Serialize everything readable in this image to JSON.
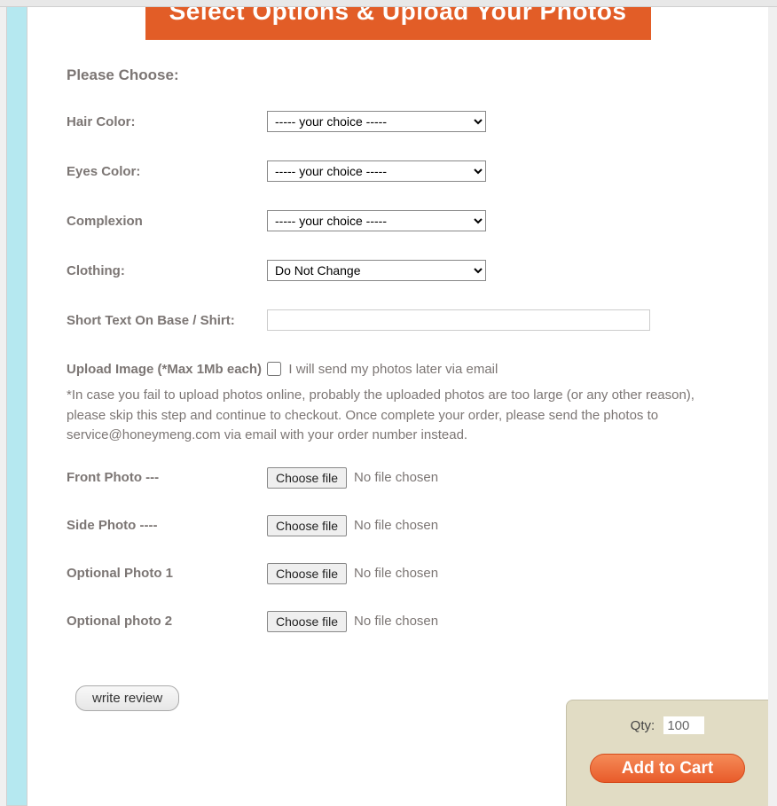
{
  "banner_title": "Select Options & Upload Your Photos",
  "heading": "Please Choose:",
  "options": {
    "hair": {
      "label": "Hair Color:",
      "selected": "----- your choice -----"
    },
    "eyes": {
      "label": "Eyes Color:",
      "selected": "----- your choice -----"
    },
    "complexion": {
      "label": "Complexion",
      "selected": "----- your choice -----"
    },
    "clothing": {
      "label": "Clothing:",
      "selected": "Do Not Change"
    },
    "short_text": {
      "label": "Short Text On Base / Shirt:",
      "value": ""
    }
  },
  "upload": {
    "title_bold": "Upload Image (*Max 1Mb each)",
    "checkbox_label": "I will send my photos later via email",
    "note": "*In case you fail to upload photos online, probably the uploaded photos are too large (or any other reason), please skip this step and continue to checkout. Once complete your order, please send the photos to service@honeymeng.com via email with your order number instead.",
    "choose_file_label": "Choose file",
    "no_file_label": "No file chosen",
    "photos": {
      "front": "Front Photo ---",
      "side": "Side Photo ----",
      "opt1": "Optional Photo 1",
      "opt2": "Optional photo 2"
    }
  },
  "review_button": "write review",
  "cart": {
    "qty_label": "Qty:",
    "qty_value": "100",
    "add_label": "Add to Cart"
  }
}
